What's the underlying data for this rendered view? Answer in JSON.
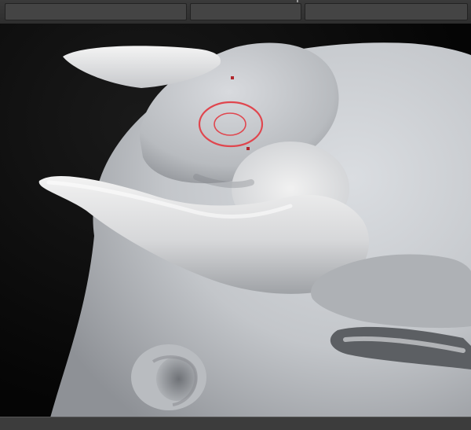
{
  "app": {
    "title": ""
  },
  "viewport": {
    "subject": "sculpted-creature-head",
    "brush_cursor": {
      "shape": "double-ring",
      "color": "#e0464e"
    }
  },
  "colors": {
    "background": "#050505",
    "clay": "#c9ccd0",
    "cursor": "#e0464e",
    "toolbar": "#333333"
  }
}
